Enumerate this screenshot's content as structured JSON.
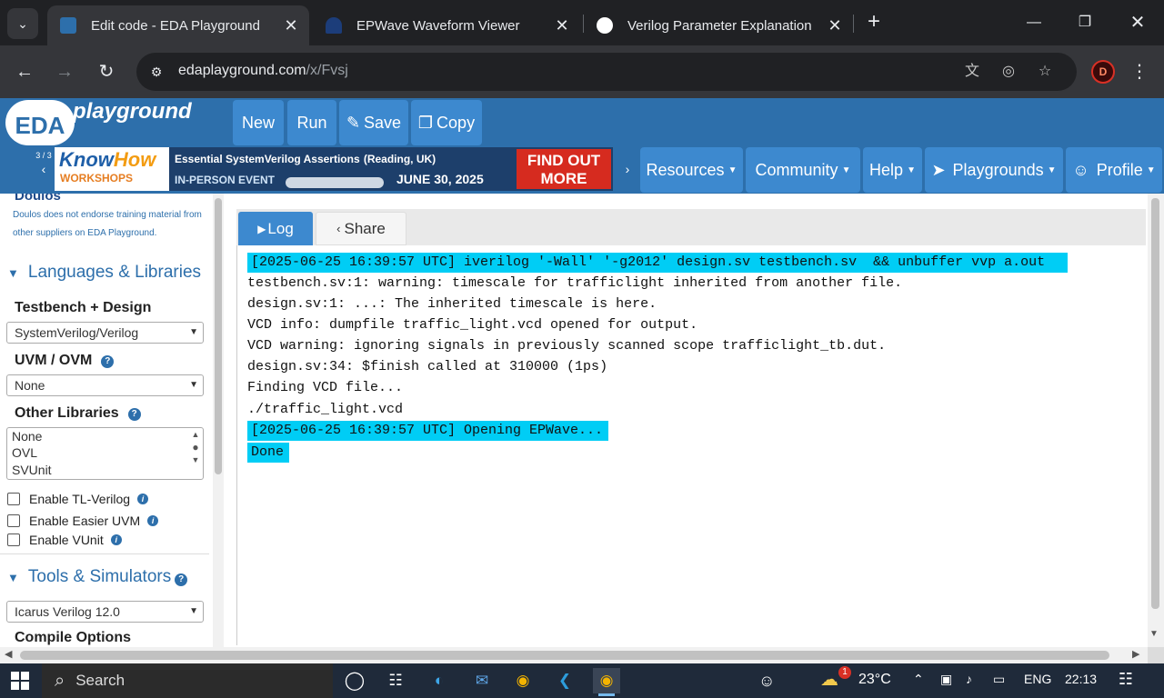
{
  "browser": {
    "tabs": [
      {
        "title": "Edit code - EDA Playground",
        "active": true
      },
      {
        "title": "EPWave Waveform Viewer",
        "active": false
      },
      {
        "title": "Verilog Parameter Explanation",
        "active": false
      }
    ],
    "url_host": "edaplayground.com",
    "url_path": "/x/Fvsj",
    "extension_letter": "D"
  },
  "header": {
    "logo": "EDA",
    "logo_text": "playground",
    "buttons": [
      "New",
      "Run",
      "Save",
      "Copy"
    ],
    "banner": {
      "counter": "3 / 3",
      "brand_know": "Know",
      "brand_how": "How",
      "brand_sub": "WORKSHOPS",
      "headline": "Essential SystemVerilog Assertions",
      "headline_sub": "(Reading, UK)",
      "event": "IN-PERSON EVENT",
      "date": "JUNE 30, 2025",
      "cta": "FIND OUT MORE"
    },
    "menus": [
      "Resources",
      "Community",
      "Help",
      "Playgrounds",
      "Profile"
    ]
  },
  "sidebar": {
    "sponsor": "Doulos",
    "note": "Doulos does not endorse training material from other suppliers on EDA Playground.",
    "languages_title": "Languages & Libraries",
    "testbench_label": "Testbench + Design",
    "testbench_value": "SystemVerilog/Verilog",
    "uvm_label": "UVM / OVM",
    "uvm_value": "None",
    "other_label": "Other Libraries",
    "other_options": [
      "None",
      "OVL",
      "SVUnit"
    ],
    "checkboxes": [
      "Enable TL-Verilog",
      "Enable Easier UVM",
      "Enable VUnit"
    ],
    "tools_title": "Tools & Simulators",
    "simulator_value": "Icarus Verilog 12.0",
    "compile_label": "Compile Options"
  },
  "main": {
    "tab_log": "Log",
    "tab_share": "Share",
    "log": [
      {
        "text": "[2025-06-25 16:39:57 UTC] iverilog '-Wall' '-g2012' design.sv testbench.sv  && unbuffer vvp a.out",
        "highlight": true
      },
      {
        "text": "testbench.sv:1: warning: timescale for trafficlight inherited from another file.",
        "highlight": false
      },
      {
        "text": "design.sv:1: ...: The inherited timescale is here.",
        "highlight": false
      },
      {
        "text": "VCD info: dumpfile traffic_light.vcd opened for output.",
        "highlight": false
      },
      {
        "text": "VCD warning: ignoring signals in previously scanned scope trafficlight_tb.dut.",
        "highlight": false
      },
      {
        "text": "design.sv:34: $finish called at 310000 (1ps)",
        "highlight": false
      },
      {
        "text": "Finding VCD file...",
        "highlight": false
      },
      {
        "text": "./traffic_light.vcd",
        "highlight": false
      },
      {
        "text": "[2025-06-25 16:39:57 UTC] Opening EPWave...",
        "highlight": true
      },
      {
        "text": "Done",
        "highlight": true
      }
    ]
  },
  "taskbar": {
    "search": "Search",
    "weather_badge": "1",
    "temperature": "23°C",
    "language": "ENG",
    "time": "22:13"
  },
  "colors": {
    "brand_blue": "#2d6fab",
    "button_blue": "#3d89cf",
    "log_highlight": "#00cdf5"
  }
}
